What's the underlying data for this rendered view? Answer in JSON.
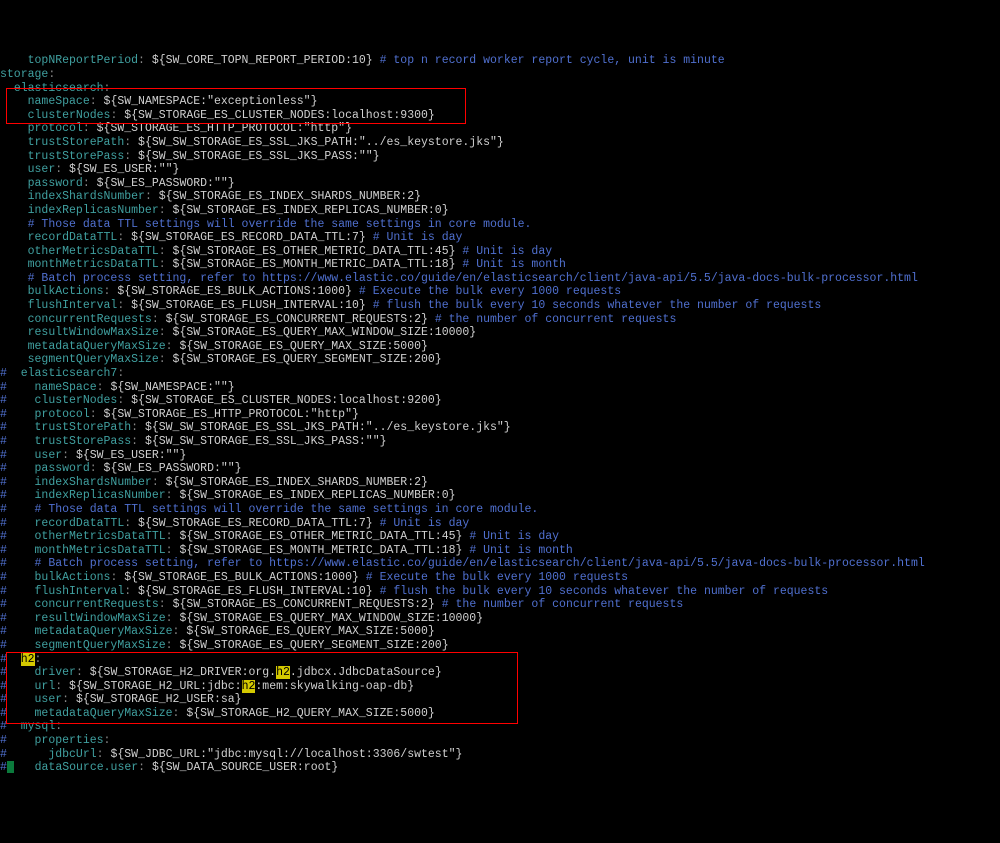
{
  "indent1": "  ",
  "indent2": "    ",
  "indent3": "      ",
  "topLine": {
    "key": "topNReportPeriod",
    "val": "${SW_CORE_TOPN_REPORT_PERIOD:10}",
    "cmt": "# top n record worker report cycle, unit is minute"
  },
  "storage": "storage",
  "es": "elasticsearch",
  "lines": [
    {
      "key": "nameSpace",
      "val": "${SW_NAMESPACE:\"exceptionless\"}"
    },
    {
      "key": "clusterNodes",
      "val": "${SW_STORAGE_ES_CLUSTER_NODES:localhost:9300}"
    },
    {
      "key": "protocol",
      "val": "${SW_STORAGE_ES_HTTP_PROTOCOL:\"http\"}"
    },
    {
      "key": "trustStorePath",
      "val": "${SW_SW_STORAGE_ES_SSL_JKS_PATH:\"../es_keystore.jks\"}"
    },
    {
      "key": "trustStorePass",
      "val": "${SW_SW_STORAGE_ES_SSL_JKS_PASS:\"\"}"
    },
    {
      "key": "user",
      "val": "${SW_ES_USER:\"\"}"
    },
    {
      "key": "password",
      "val": "${SW_ES_PASSWORD:\"\"}"
    },
    {
      "key": "indexShardsNumber",
      "val": "${SW_STORAGE_ES_INDEX_SHARDS_NUMBER:2}"
    },
    {
      "key": "indexReplicasNumber",
      "val": "${SW_STORAGE_ES_INDEX_REPLICAS_NUMBER:0}"
    },
    {
      "cmt": "# Those data TTL settings will override the same settings in core module."
    },
    {
      "key": "recordDataTTL",
      "val": "${SW_STORAGE_ES_RECORD_DATA_TTL:7}",
      "trail": "# Unit is day"
    },
    {
      "key": "otherMetricsDataTTL",
      "val": "${SW_STORAGE_ES_OTHER_METRIC_DATA_TTL:45}",
      "trail": "# Unit is day"
    },
    {
      "key": "monthMetricsDataTTL",
      "val": "${SW_STORAGE_ES_MONTH_METRIC_DATA_TTL:18}",
      "trail": "# Unit is month"
    },
    {
      "cmt": "# Batch process setting, refer to https://www.elastic.co/guide/en/elasticsearch/client/java-api/5.5/java-docs-bulk-processor.html"
    },
    {
      "key": "bulkActions",
      "val": "${SW_STORAGE_ES_BULK_ACTIONS:1000}",
      "trail": "# Execute the bulk every 1000 requests"
    },
    {
      "key": "flushInterval",
      "val": "${SW_STORAGE_ES_FLUSH_INTERVAL:10}",
      "trail": "# flush the bulk every 10 seconds whatever the number of requests"
    },
    {
      "key": "concurrentRequests",
      "val": "${SW_STORAGE_ES_CONCURRENT_REQUESTS:2}",
      "trail": "# the number of concurrent requests"
    },
    {
      "key": "resultWindowMaxSize",
      "val": "${SW_STORAGE_ES_QUERY_MAX_WINDOW_SIZE:10000}"
    },
    {
      "key": "metadataQueryMaxSize",
      "val": "${SW_STORAGE_ES_QUERY_MAX_SIZE:5000}"
    },
    {
      "key": "segmentQueryMaxSize",
      "val": "${SW_STORAGE_ES_QUERY_SEGMENT_SIZE:200}"
    }
  ],
  "es7": "elasticsearch7",
  "lines7": [
    {
      "key": "nameSpace",
      "val": "${SW_NAMESPACE:\"\"}"
    },
    {
      "key": "clusterNodes",
      "val": "${SW_STORAGE_ES_CLUSTER_NODES:localhost:9200}"
    },
    {
      "key": "protocol",
      "val": "${SW_STORAGE_ES_HTTP_PROTOCOL:\"http\"}"
    },
    {
      "key": "trustStorePath",
      "val": "${SW_SW_STORAGE_ES_SSL_JKS_PATH:\"../es_keystore.jks\"}"
    },
    {
      "key": "trustStorePass",
      "val": "${SW_SW_STORAGE_ES_SSL_JKS_PASS:\"\"}"
    },
    {
      "key": "user",
      "val": "${SW_ES_USER:\"\"}"
    },
    {
      "key": "password",
      "val": "${SW_ES_PASSWORD:\"\"}"
    },
    {
      "key": "indexShardsNumber",
      "val": "${SW_STORAGE_ES_INDEX_SHARDS_NUMBER:2}"
    },
    {
      "key": "indexReplicasNumber",
      "val": "${SW_STORAGE_ES_INDEX_REPLICAS_NUMBER:0}"
    },
    {
      "cmt": "# Those data TTL settings will override the same settings in core module."
    },
    {
      "key": "recordDataTTL",
      "val": "${SW_STORAGE_ES_RECORD_DATA_TTL:7}",
      "trail": "# Unit is day"
    },
    {
      "key": "otherMetricsDataTTL",
      "val": "${SW_STORAGE_ES_OTHER_METRIC_DATA_TTL:45}",
      "trail": "# Unit is day"
    },
    {
      "key": "monthMetricsDataTTL",
      "val": "${SW_STORAGE_ES_MONTH_METRIC_DATA_TTL:18}",
      "trail": "# Unit is month"
    },
    {
      "cmt": "# Batch process setting, refer to https://www.elastic.co/guide/en/elasticsearch/client/java-api/5.5/java-docs-bulk-processor.html"
    },
    {
      "key": "bulkActions",
      "val": "${SW_STORAGE_ES_BULK_ACTIONS:1000}",
      "trail": "# Execute the bulk every 1000 requests"
    },
    {
      "key": "flushInterval",
      "val": "${SW_STORAGE_ES_FLUSH_INTERVAL:10}",
      "trail": "# flush the bulk every 10 seconds whatever the number of requests"
    },
    {
      "key": "concurrentRequests",
      "val": "${SW_STORAGE_ES_CONCURRENT_REQUESTS:2}",
      "trail": "# the number of concurrent requests"
    },
    {
      "key": "resultWindowMaxSize",
      "val": "${SW_STORAGE_ES_QUERY_MAX_WINDOW_SIZE:10000}"
    },
    {
      "key": "metadataQueryMaxSize",
      "val": "${SW_STORAGE_ES_QUERY_MAX_SIZE:5000}"
    },
    {
      "key": "segmentQueryMaxSize",
      "val": "${SW_STORAGE_ES_QUERY_SEGMENT_SIZE:200}"
    }
  ],
  "h2": {
    "label": "h2",
    "driver_k": "driver",
    "driver_pre": "${SW_STORAGE_H2_DRIVER:org.",
    "driver_hl": "h2",
    "driver_post": ".jdbcx.JdbcDataSource}",
    "url_k": "url",
    "url_pre": "${SW_STORAGE_H2_URL:jdbc:",
    "url_hl": "h2",
    "url_post": ":mem:skywalking-oap-db}",
    "user_k": "user",
    "user_v": "${SW_STORAGE_H2_USER:sa}",
    "mq_k": "metadataQueryMaxSize",
    "mq_v": "${SW_STORAGE_H2_QUERY_MAX_SIZE:5000}"
  },
  "mysql": {
    "label": "mysql",
    "props": "properties",
    "jk": "jdbcUrl",
    "jv": "${SW_JDBC_URL:\"jdbc:mysql://localhost:3306/swtest\"}",
    "du": "dataSource.user",
    "dv": "${SW_DATA_SOURCE_USER:root}"
  }
}
